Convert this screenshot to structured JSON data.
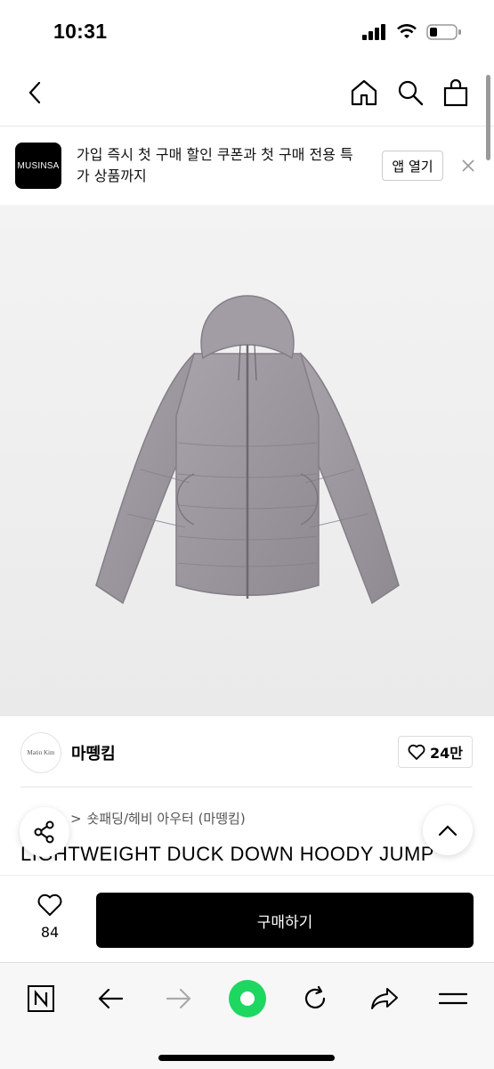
{
  "status": {
    "time": "10:31"
  },
  "banner": {
    "logo_text": "MUSINSA",
    "message": "가입 즉시 첫 구매 할인 쿠폰과 첫 구매 전용 특가 상품까지",
    "open_label": "앱 열기"
  },
  "brand": {
    "logo_text": "Matin Kim",
    "name": "마뗑킴",
    "likes": "24만"
  },
  "product": {
    "breadcrumb_category": "숏패딩/헤비 아우터 (마뗑킴)",
    "title": "LIGHTWEIGHT DUCK DOWN HOODY JUMP"
  },
  "buy_bar": {
    "wish_count": "84",
    "buy_label": "구매하기"
  },
  "icons": {
    "back": "chevron-left-icon",
    "home": "home-icon",
    "search": "search-icon",
    "cart": "bag-icon"
  },
  "colors": {
    "accent_green": "#1ed760",
    "jacket": "#9a959c"
  }
}
